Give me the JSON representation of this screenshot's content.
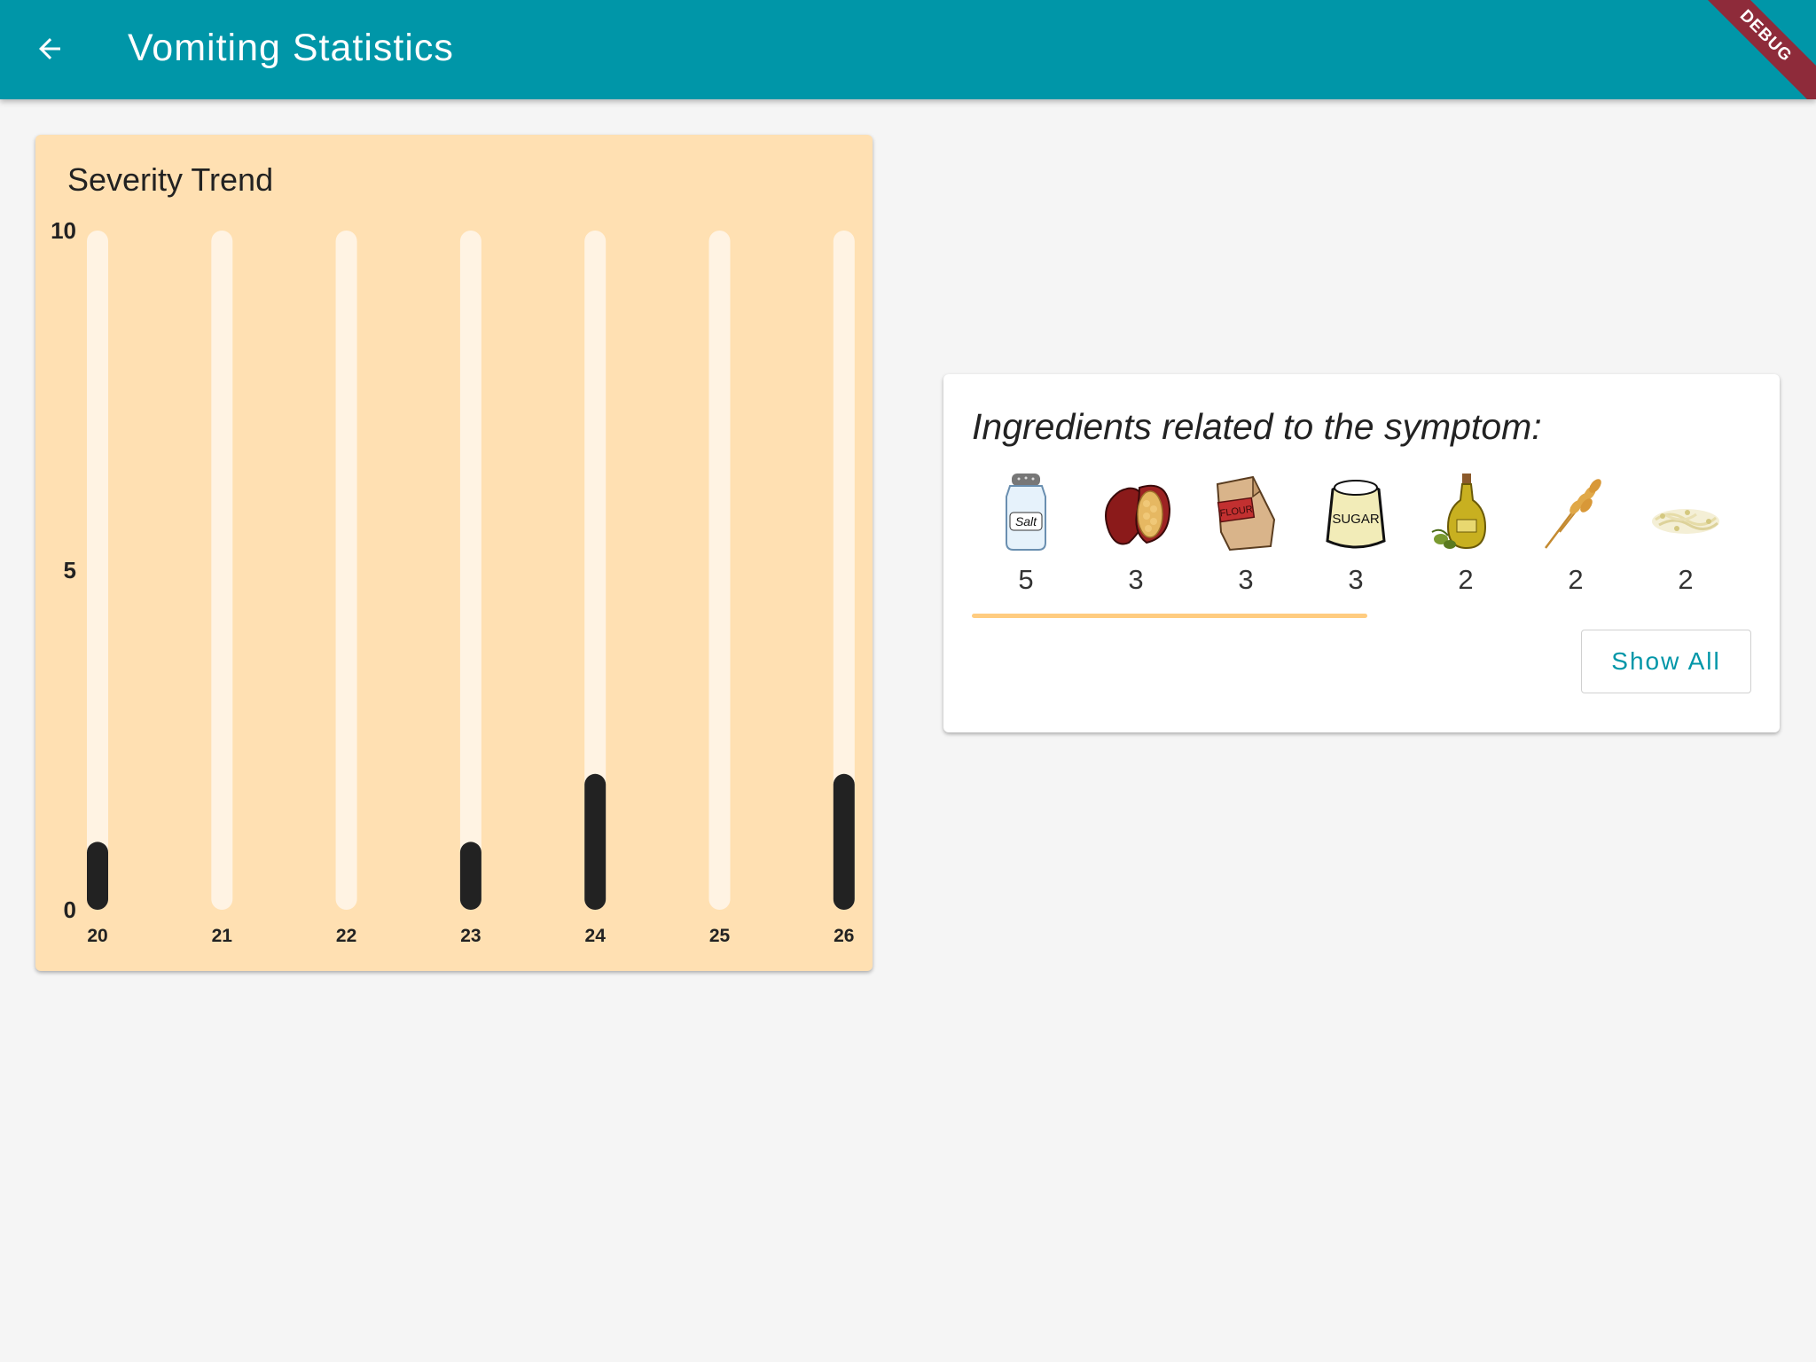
{
  "appbar": {
    "title": "Vomiting Statistics",
    "back_icon": "arrow-left-icon",
    "debug_label": "DEBUG",
    "color": "#0096a8"
  },
  "severity": {
    "title": "Severity Trend",
    "chart_data": {
      "type": "bar",
      "categories": [
        "20",
        "21",
        "22",
        "23",
        "24",
        "25",
        "26"
      ],
      "values": [
        1,
        0,
        0,
        1,
        2,
        0,
        2
      ],
      "ylim": [
        0,
        10
      ],
      "yticks": [
        "0",
        "5",
        "10"
      ],
      "bar_color": "#222222",
      "track_color": "#fff3e3",
      "background": "#ffe0b2"
    }
  },
  "ingredients": {
    "title": "Ingredients related to the symptom:",
    "items": [
      {
        "icon": "salt-shaker-icon",
        "label": "Salt",
        "count": "5"
      },
      {
        "icon": "cocoa-pod-icon",
        "count": "3"
      },
      {
        "icon": "flour-bag-icon",
        "label": "FLOUR",
        "count": "3"
      },
      {
        "icon": "sugar-sack-icon",
        "label": "SUGAR",
        "count": "3"
      },
      {
        "icon": "olive-oil-icon",
        "count": "2"
      },
      {
        "icon": "wheat-icon",
        "count": "2"
      },
      {
        "icon": "bean-sprouts-icon",
        "count": "2"
      }
    ],
    "show_all_label": "Show All",
    "accent": "#ffcc80"
  }
}
